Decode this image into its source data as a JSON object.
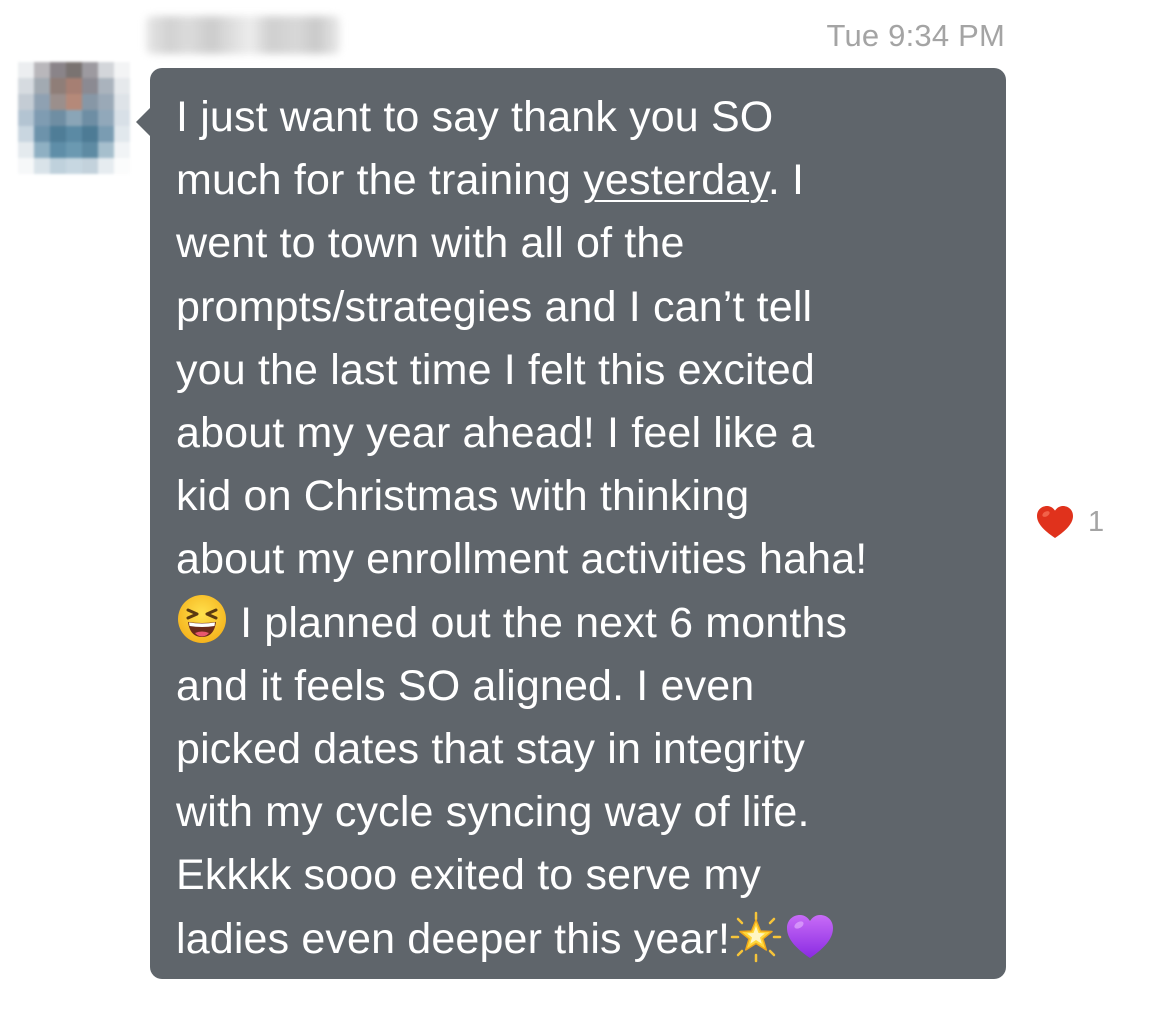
{
  "conversation": {
    "timestamp": "Tue 9:34 PM",
    "sender": {
      "avatar_icon": "pixelated-avatar",
      "name_blurred": true
    },
    "message": {
      "bubble_color": "#5f656b",
      "line1": "I just want to say thank you SO",
      "line2_pre": "much for the training ",
      "line2_link": "yesterday",
      "line2_post": ". I",
      "line3_to_9": "went to town with all of the\nprompts/strategies and I can’t tell\nyou the last time I felt this excited\nabout my year ahead! I feel like a\nkid on Christmas with thinking\nabout my enrollment activities haha!",
      "line10_emoji": "grinning-squinting-face-emoji",
      "line10_text": " I planned out the next 6 months",
      "rest": "and it feels SO aligned. I even\npicked dates that stay in integrity\nwith my cycle syncing way of life.\nEkkkk sooo exited to serve my",
      "last_line": "ladies even deeper this year!",
      "end_emojis": [
        "glowing-star-emoji",
        "purple-heart-emoji"
      ]
    },
    "reaction": {
      "icon": "red-heart-icon",
      "color": "#e0321c",
      "count": "1"
    }
  }
}
